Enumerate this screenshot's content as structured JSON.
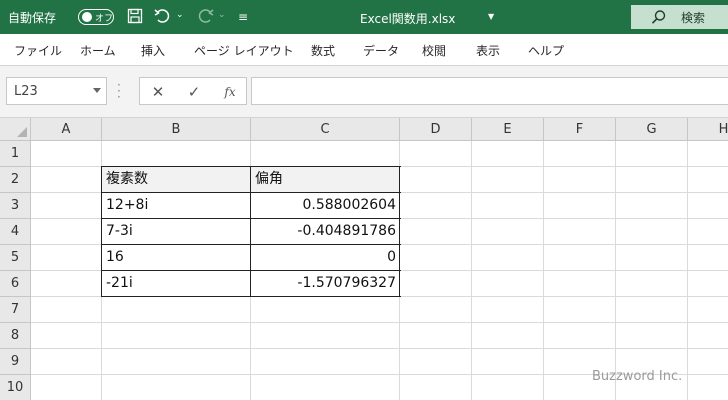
{
  "titlebar": {
    "autosave_label": "自動保存",
    "autosave_state": "オフ",
    "filename": "Excel関数用.xlsx",
    "search_label": "検索",
    "bg_color": "#217346"
  },
  "menu": [
    "ファイル",
    "ホーム",
    "挿入",
    "ページ レイアウト",
    "数式",
    "データ",
    "校閲",
    "表示",
    "ヘルプ"
  ],
  "formula_bar": {
    "name_box": "L23",
    "fx_label": "fx",
    "value": ""
  },
  "columns": [
    "A",
    "B",
    "C",
    "D",
    "E",
    "F",
    "G",
    "H"
  ],
  "rows": [
    "1",
    "2",
    "3",
    "4",
    "5",
    "6",
    "7",
    "8",
    "9",
    "10"
  ],
  "table": {
    "headers": [
      "複素数",
      "偏角"
    ],
    "rows": [
      [
        "12+8i",
        "0.588002604"
      ],
      [
        "7-3i",
        "-0.404891786"
      ],
      [
        "16",
        "0"
      ],
      [
        "-21i",
        "-1.570796327"
      ]
    ]
  },
  "watermark": "Buzzword Inc."
}
